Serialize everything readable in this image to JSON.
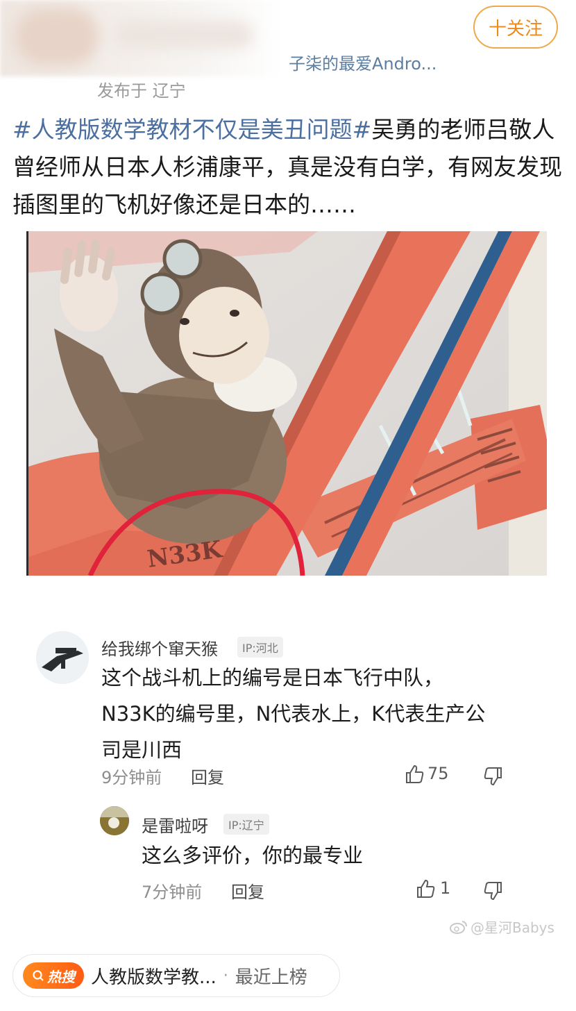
{
  "header": {
    "follow_label": "十关注",
    "source": "子柒的最爱Andro...",
    "published": "发布于 辽宁"
  },
  "post": {
    "hashtag": "#人教版数学教材不仅是美丑问题#",
    "body": "吴勇的老师吕敬人曾经师从日本人杉浦康平，真是没有白学，有网友发现插图里的飞机好像还是日本的……"
  },
  "illustration": {
    "plane_code": "N33K"
  },
  "comments": [
    {
      "username": "给我绑个窜天猴",
      "ip": "IP:河北",
      "text_lines": [
        "这个战斗机上的编号是日本飞行中队，",
        "N33K的编号里，N代表水上，K代表生产公",
        "司是川西"
      ],
      "time": "9分钟前",
      "reply_label": "回复",
      "likes": "75"
    },
    {
      "username": "是雷啦呀",
      "ip": "IP:辽宁",
      "text_lines": [
        "这么多评价，你的最专业"
      ],
      "time": "7分钟前",
      "reply_label": "回复",
      "likes": "1"
    }
  ],
  "watermark": "@星河Babys",
  "hot_bar": {
    "badge": "热搜",
    "title": "人教版数学教...",
    "separator": "·",
    "status": "最近上榜"
  },
  "colors": {
    "accent_orange": "#ec8a1a",
    "hashtag_blue": "#4a6fa0",
    "plane_red": "#e8735a",
    "circle_red": "#e0223a"
  }
}
